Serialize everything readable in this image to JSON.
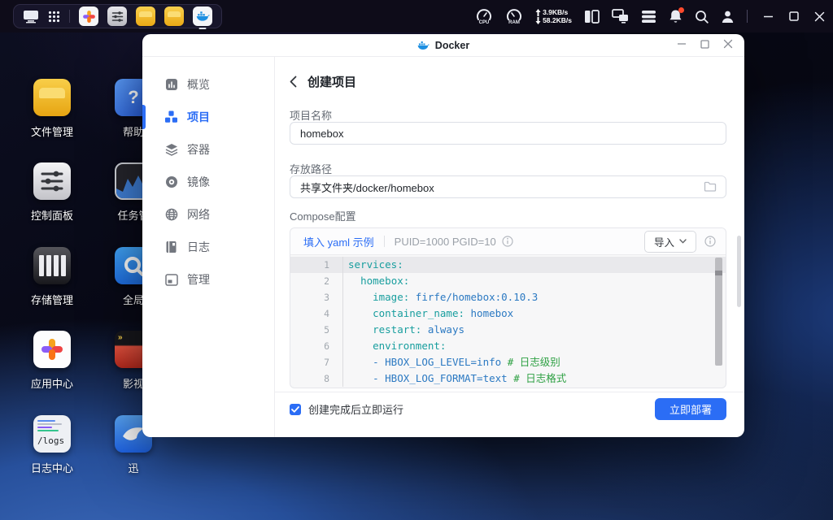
{
  "colors": {
    "accent": "#2b6df5",
    "editor_key": "#189e9e",
    "editor_value": "#2b79c2",
    "editor_comment": "#2ea043",
    "bell_badge": "#ff4a2d",
    "folder_yellow": "#f0b429"
  },
  "taskbar": {
    "cpu_label": "CPU",
    "ram_label": "RAM",
    "net_up": "3.9KB/s",
    "net_down": "58.2KB/s"
  },
  "desktop": {
    "column1": [
      {
        "label": "文件管理"
      },
      {
        "label": "控制面板"
      },
      {
        "label": "存储管理"
      },
      {
        "label": "应用中心"
      },
      {
        "label": "日志中心"
      }
    ],
    "column2": [
      {
        "label": "帮助"
      },
      {
        "label": "任务管"
      },
      {
        "label": "全局"
      },
      {
        "label": "影视"
      },
      {
        "label": "迅"
      }
    ],
    "logs_icon_text": "/logs",
    "movie_icon_text": "»"
  },
  "window": {
    "title": "Docker",
    "sidebar": {
      "items": [
        {
          "label": "概览"
        },
        {
          "label": "项目",
          "active": true
        },
        {
          "label": "容器"
        },
        {
          "label": "镜像"
        },
        {
          "label": "网络"
        },
        {
          "label": "日志"
        },
        {
          "label": "管理"
        }
      ]
    },
    "form": {
      "header": "创建项目",
      "name_label": "项目名称",
      "name_value": "homebox",
      "path_label": "存放路径",
      "path_value": "共享文件夹/docker/homebox",
      "compose_label": "Compose配置",
      "toolbar": {
        "fill_example": "填入 yaml 示例",
        "hint": "PUID=1000 PGID=10",
        "import_label": "导入"
      },
      "editor": {
        "lines": [
          {
            "n": 1,
            "active": true,
            "parts": [
              {
                "t": "key",
                "s": "services:"
              }
            ]
          },
          {
            "n": 2,
            "parts": [
              {
                "t": "pln",
                "s": "  "
              },
              {
                "t": "key",
                "s": "homebox:"
              }
            ]
          },
          {
            "n": 3,
            "parts": [
              {
                "t": "pln",
                "s": "    "
              },
              {
                "t": "key",
                "s": "image:"
              },
              {
                "t": "pln",
                "s": " "
              },
              {
                "t": "val",
                "s": "firfe/homebox:0.10.3"
              }
            ]
          },
          {
            "n": 4,
            "parts": [
              {
                "t": "pln",
                "s": "    "
              },
              {
                "t": "key",
                "s": "container_name:"
              },
              {
                "t": "pln",
                "s": " "
              },
              {
                "t": "val",
                "s": "homebox"
              }
            ]
          },
          {
            "n": 5,
            "parts": [
              {
                "t": "pln",
                "s": "    "
              },
              {
                "t": "key",
                "s": "restart:"
              },
              {
                "t": "pln",
                "s": " "
              },
              {
                "t": "val",
                "s": "always"
              }
            ]
          },
          {
            "n": 6,
            "parts": [
              {
                "t": "pln",
                "s": "    "
              },
              {
                "t": "key",
                "s": "environment:"
              }
            ]
          },
          {
            "n": 7,
            "parts": [
              {
                "t": "pln",
                "s": "    "
              },
              {
                "t": "val",
                "s": "- HBOX_LOG_LEVEL=info "
              },
              {
                "t": "com",
                "s": "# 日志级别"
              }
            ]
          },
          {
            "n": 8,
            "parts": [
              {
                "t": "pln",
                "s": "    "
              },
              {
                "t": "val",
                "s": "- HBOX_LOG_FORMAT=text "
              },
              {
                "t": "com",
                "s": "# 日志格式"
              }
            ]
          }
        ]
      },
      "footer": {
        "run_label": "创建完成后立即运行",
        "deploy_label": "立即部署"
      }
    }
  }
}
